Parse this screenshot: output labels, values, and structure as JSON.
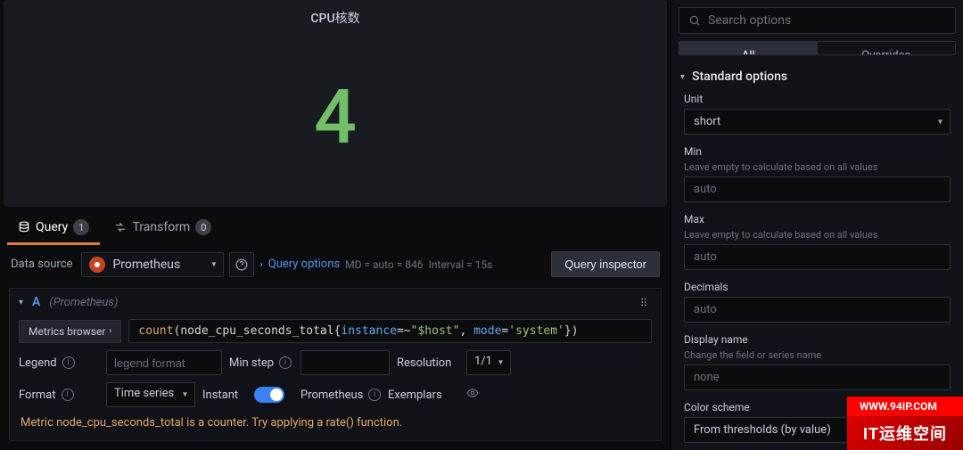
{
  "panel": {
    "title": "CPU核数",
    "value": "4"
  },
  "tabs": {
    "query": "Query",
    "query_badge": "1",
    "transform": "Transform",
    "transform_badge": "0"
  },
  "ds": {
    "label": "Data source",
    "name": "Prometheus",
    "query_options": "Query options",
    "meta_md": "MD = auto = 846",
    "meta_interval": "Interval = 15s",
    "inspector": "Query inspector"
  },
  "query": {
    "letter": "A",
    "source_hint": "(Prometheus)",
    "browser_btn": "Metrics browser",
    "expr_fn": "count",
    "expr_metric": "node_cpu_seconds_total",
    "expr_k1": "instance",
    "expr_op1": "=~",
    "expr_v1": "\"$host\"",
    "expr_k2": "mode",
    "expr_op2": "=",
    "expr_v2": "'system'",
    "legend_label": "Legend",
    "legend_placeholder": "legend format",
    "minstep_label": "Min step",
    "resolution_label": "Resolution",
    "resolution_value": "1/1",
    "format_label": "Format",
    "format_value": "Time series",
    "instant_label": "Instant",
    "prom_label": "Prometheus",
    "exemplars_label": "Exemplars",
    "hint": "Metric node_cpu_seconds_total is a counter. Try applying a rate() function."
  },
  "sidebar": {
    "search_placeholder": "Search options",
    "tab_all": "All",
    "tab_overrides": "Overrides",
    "section": "Standard options",
    "unit_label": "Unit",
    "unit_value": "short",
    "min_label": "Min",
    "min_help": "Leave empty to calculate based on all values",
    "min_value": "auto",
    "max_label": "Max",
    "max_help": "Leave empty to calculate based on all values",
    "max_value": "auto",
    "decimals_label": "Decimals",
    "decimals_value": "auto",
    "display_label": "Display name",
    "display_help": "Change the field or series name",
    "display_value": "none",
    "color_label": "Color scheme",
    "color_value": "From thresholds (by value)"
  },
  "watermark": {
    "top": "WWW.94IP.COM",
    "bottom": "IT运维空间"
  }
}
